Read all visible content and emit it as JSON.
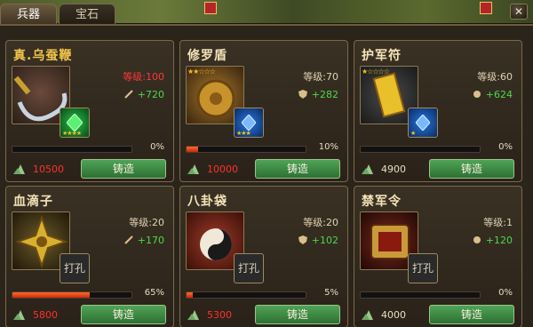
{
  "tabs": [
    {
      "label": "兵器",
      "active": true
    },
    {
      "label": "宝石",
      "active": false
    }
  ],
  "cards": [
    {
      "name": "真.乌蚕鞭",
      "name_color": "gold",
      "stars": "",
      "level": "等级:100",
      "level_red": true,
      "stat_icon": "sword-icon",
      "stat": "+720",
      "gem": "green-gem",
      "gem_stars": "★★★★",
      "progress": 0,
      "percent": "0%",
      "cost": "10500",
      "cost_red": true,
      "button": "铸造"
    },
    {
      "name": "修罗盾",
      "name_color": "white",
      "stars": "★★☆☆☆",
      "level": "等级:70",
      "level_red": false,
      "stat_icon": "shield-icon",
      "stat": "+282",
      "gem": "blue-gem",
      "gem_stars": "★★★",
      "progress": 10,
      "percent": "10%",
      "cost": "10000",
      "cost_red": true,
      "button": "铸造"
    },
    {
      "name": "护军符",
      "name_color": "white",
      "stars": "★☆☆☆☆",
      "level": "等级:60",
      "level_red": false,
      "stat_icon": "hp-icon",
      "stat": "+624",
      "gem": "blue-gem",
      "gem_stars": "★",
      "progress": 0,
      "percent": "0%",
      "cost": "4900",
      "cost_red": false,
      "button": "铸造"
    },
    {
      "name": "血滴子",
      "name_color": "white",
      "stars": "",
      "level": "等级:20",
      "level_red": false,
      "stat_icon": "sword-icon",
      "stat": "+170",
      "gem": "empty",
      "gem_label": "打孔",
      "progress": 65,
      "percent": "65%",
      "cost": "5800",
      "cost_red": true,
      "button": "铸造"
    },
    {
      "name": "八卦袋",
      "name_color": "white",
      "stars": "",
      "level": "等级:20",
      "level_red": false,
      "stat_icon": "shield-icon",
      "stat": "+102",
      "gem": "empty",
      "gem_label": "打孔",
      "progress": 5,
      "percent": "5%",
      "cost": "5300",
      "cost_red": true,
      "button": "铸造"
    },
    {
      "name": "禁军令",
      "name_color": "white",
      "stars": "",
      "level": "等级:1",
      "level_red": false,
      "stat_icon": "hp-icon",
      "stat": "+120",
      "gem": "empty",
      "gem_label": "打孔",
      "progress": 0,
      "percent": "0%",
      "cost": "4000",
      "cost_red": false,
      "button": "铸造"
    }
  ]
}
